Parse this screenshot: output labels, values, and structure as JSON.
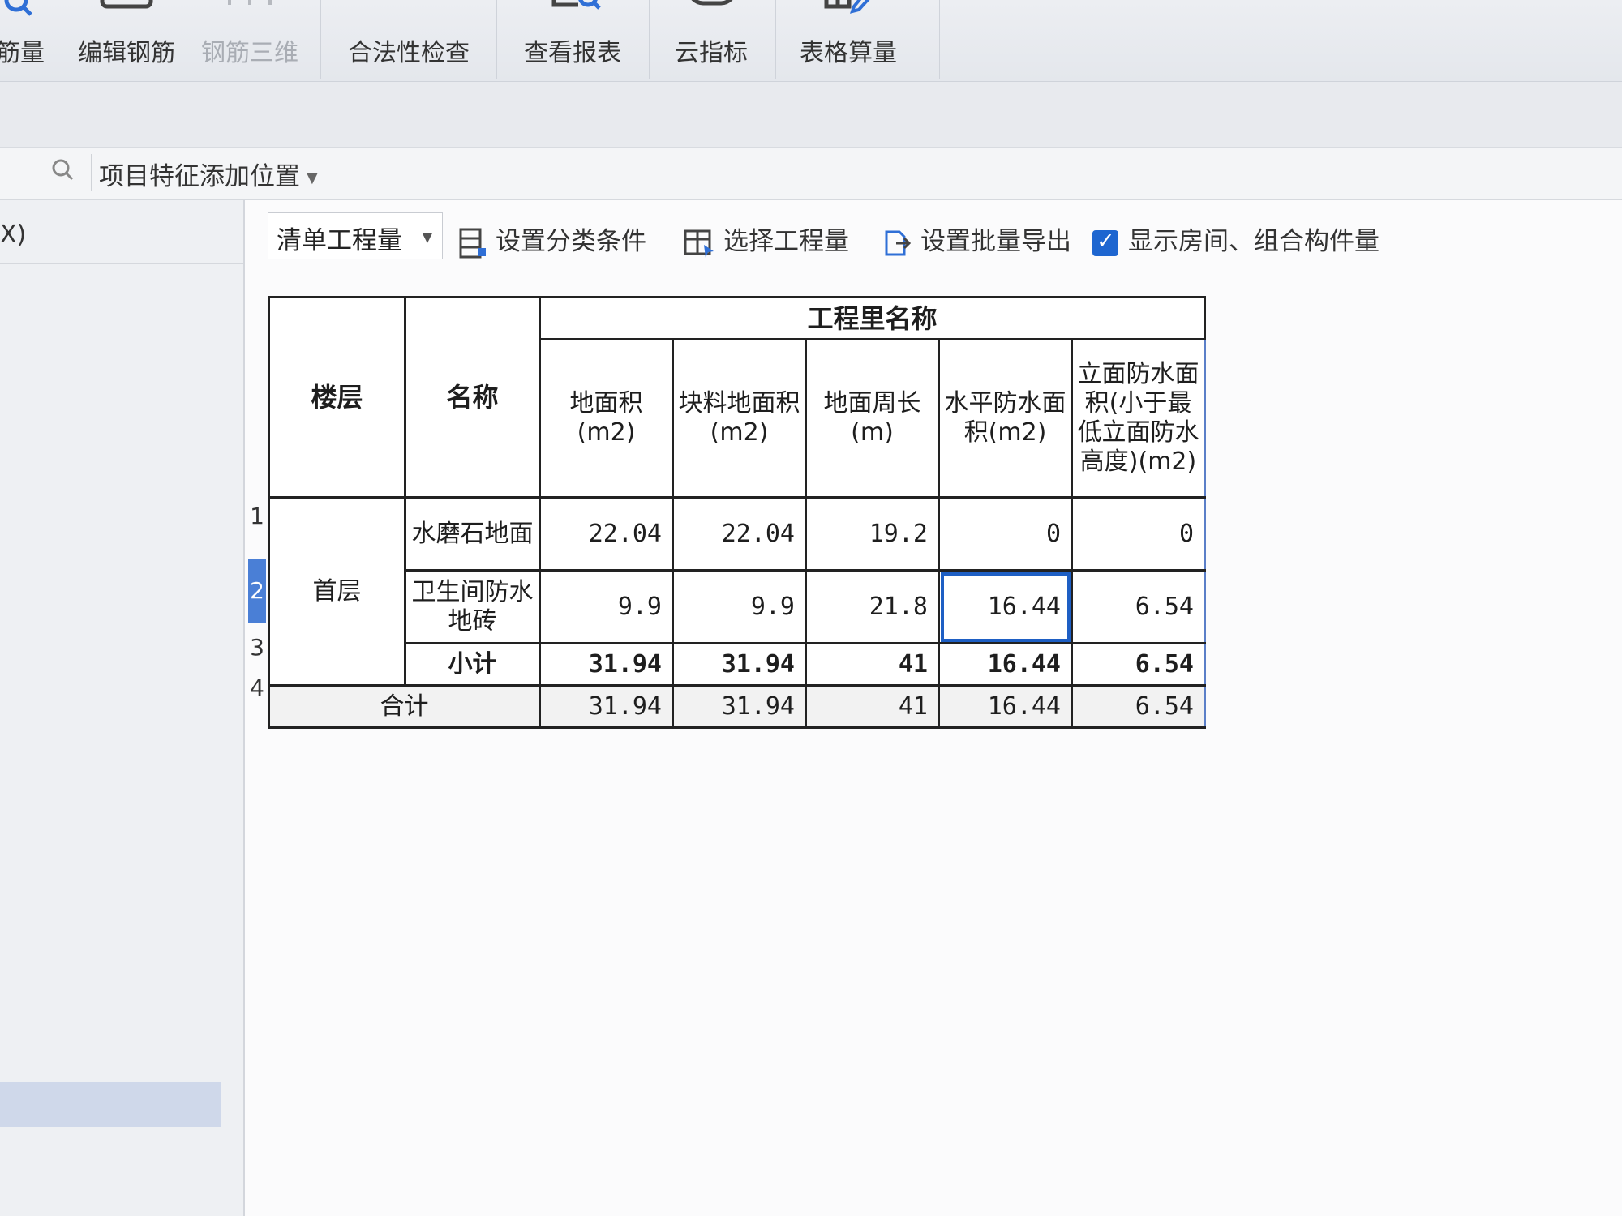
{
  "ribbon": {
    "items": [
      {
        "label": "筋量",
        "icon": "search-icon",
        "enabled": true
      },
      {
        "label": "编辑钢筋",
        "icon": "edit-rebar-icon",
        "enabled": true
      },
      {
        "label": "钢筋三维",
        "icon": "rebar-3d-icon",
        "enabled": false
      },
      {
        "label": "合法性检查",
        "icon": "check-icon",
        "enabled": true
      },
      {
        "label": "查看报表",
        "icon": "report-search-icon",
        "enabled": true
      },
      {
        "label": "云指标",
        "icon": "cloud-index-icon",
        "enabled": true
      },
      {
        "label": "表格算量",
        "icon": "table-edit-icon",
        "enabled": true
      }
    ]
  },
  "feature_bar": {
    "dropdown_label": "项目特征添加位置"
  },
  "left_panel": {
    "title_fragment": "X)"
  },
  "toolbar": {
    "quantity_dropdown": "清单工程量",
    "set_category": "设置分类条件",
    "select_quantity": "选择工程量",
    "batch_export": "设置批量导出",
    "show_rooms": "显示房间、组合构件量",
    "show_rooms_checked": true
  },
  "table": {
    "headers": {
      "floor": "楼层",
      "name": "名称",
      "group": "工程里名称",
      "columns": [
        "地面积(m2)",
        "块料地面积(m2)",
        "地面周长(m)",
        "水平防水面积(m2)",
        "立面防水面积(小于最低立面防水高度)(m2)"
      ]
    },
    "row_numbers": [
      "1",
      "2",
      "3",
      "4"
    ],
    "floor_value": "首层",
    "rows": [
      {
        "name": "水磨石地面",
        "values": [
          "22.04",
          "22.04",
          "19.2",
          "0",
          "0"
        ]
      },
      {
        "name": "卫生间防水地砖",
        "values": [
          "9.9",
          "9.9",
          "21.8",
          "16.44",
          "6.54"
        ]
      }
    ],
    "subtotal": {
      "name": "小计",
      "values": [
        "31.94",
        "31.94",
        "41",
        "16.44",
        "6.54"
      ]
    },
    "total": {
      "name": "合计",
      "values": [
        "31.94",
        "31.94",
        "41",
        "16.44",
        "6.54"
      ]
    }
  },
  "colors": {
    "accent": "#1e5fc4",
    "checkbox": "#1e66d0",
    "active_row_marker": "#4a7fd6"
  }
}
